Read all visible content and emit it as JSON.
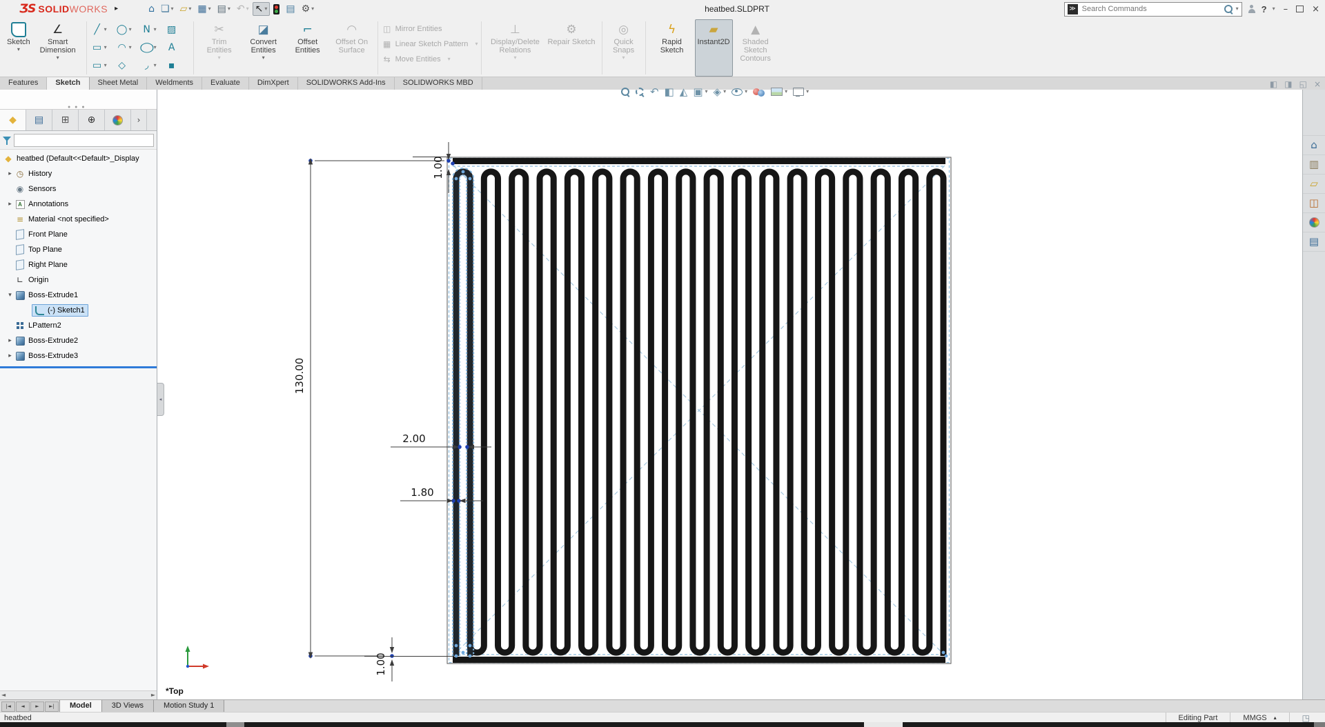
{
  "window": {
    "brand_mark": "ƷS",
    "brand_bold": "SOLID",
    "brand_light": "WORKS",
    "flyout_arrow": "▸",
    "title": "heatbed.SLDPRT",
    "search_placeholder": "Search Commands",
    "search_icon_glyph": "≫",
    "help_label": "?",
    "minimize_glyph": "–",
    "close_glyph": "×"
  },
  "quick_access": [
    {
      "name": "home",
      "glyph": "⌂",
      "color": "#2f6f9e"
    },
    {
      "name": "new-document",
      "glyph": "❏",
      "color": "#4a7d9e",
      "dd": true
    },
    {
      "name": "open",
      "glyph": "▱",
      "color": "#c9a227",
      "dd": true
    },
    {
      "name": "save",
      "glyph": "▦",
      "color": "#3a6b96",
      "dd": true
    },
    {
      "name": "print",
      "glyph": "▤",
      "color": "#5a6b76",
      "dd": true
    },
    {
      "name": "undo",
      "glyph": "↶",
      "color": "#b5b5b5",
      "dd": true,
      "disabled": true
    },
    {
      "name": "select",
      "glyph": "↖",
      "color": "#222222",
      "dd": true,
      "active": true
    },
    {
      "name": "xpert-tools",
      "glyph": "css:traffic"
    },
    {
      "name": "file-properties",
      "glyph": "▤",
      "color": "#4a7d9e"
    },
    {
      "name": "options",
      "glyph": "⚙",
      "color": "#555555",
      "dd": true
    }
  ],
  "ribbon": {
    "big": [
      {
        "name": "sketch",
        "label": "Sketch",
        "icon": "css:bigsketch",
        "dd": true,
        "enabled": true
      },
      {
        "name": "smart-dimension",
        "label": "Smart Dimension",
        "glyph": "∠",
        "color": "#2a2a2a",
        "dd": true,
        "enabled": true
      }
    ],
    "entity_grid": [
      [
        {
          "name": "line",
          "glyph": "╱",
          "dd": true
        },
        {
          "name": "circle",
          "glyph": "◯",
          "dd": true
        },
        {
          "name": "spline",
          "glyph": "N",
          "dd": true
        },
        {
          "name": "sketch-picture",
          "glyph": "▨"
        }
      ],
      [
        {
          "name": "corner-rectangle",
          "glyph": "▭",
          "dd": true
        },
        {
          "name": "arc",
          "glyph": "◠",
          "dd": true
        },
        {
          "name": "ellipse",
          "glyph": "◯",
          "dd": true
        },
        {
          "name": "text",
          "glyph": "A"
        }
      ],
      [
        {
          "name": "straight-slot",
          "glyph": "▭",
          "dd": true
        },
        {
          "name": "polygon",
          "glyph": "◇"
        },
        {
          "name": "fillet",
          "glyph": "◞",
          "dd": true
        },
        {
          "name": "point",
          "glyph": "▪"
        }
      ]
    ],
    "modify": [
      {
        "name": "trim-entities",
        "label": "Trim Entities",
        "glyph": "✂",
        "enabled": false,
        "dd": true
      },
      {
        "name": "convert-entities",
        "label": "Convert Entities",
        "glyph": "◪",
        "color": "#4a7d9e",
        "enabled": true,
        "dd": true
      },
      {
        "name": "offset-entities",
        "label": "Offset Entities",
        "glyph": "⌐",
        "color": "#1f7f95",
        "enabled": true
      },
      {
        "name": "offset-on-surface",
        "label": "Offset On Surface",
        "glyph": "◠",
        "enabled": false
      }
    ],
    "pattern": [
      {
        "name": "mirror-entities",
        "label": "Mirror Entities",
        "glyph": "◫",
        "enabled": false
      },
      {
        "name": "linear-sketch-pattern",
        "label": "Linear Sketch Pattern",
        "glyph": "▦",
        "enabled": false,
        "dd": true
      },
      {
        "name": "move-entities",
        "label": "Move Entities",
        "glyph": "⇆",
        "enabled": false,
        "dd": true
      }
    ],
    "tools": [
      {
        "name": "display-delete-relations",
        "label": "Display/Delete Relations",
        "glyph": "⊥",
        "enabled": false,
        "dd": true
      },
      {
        "name": "repair-sketch",
        "label": "Repair Sketch",
        "glyph": "⚙",
        "enabled": false
      }
    ],
    "snaps": [
      {
        "name": "quick-snaps",
        "label": "Quick Snaps",
        "glyph": "◎",
        "enabled": false,
        "dd": true
      }
    ],
    "right": [
      {
        "name": "rapid-sketch",
        "label": "Rapid Sketch",
        "glyph": "ϟ",
        "color": "#d9a018",
        "enabled": true
      },
      {
        "name": "instant2d",
        "label": "Instant2D",
        "glyph": "▰",
        "color": "#caa53d",
        "enabled": true,
        "pressed": true
      },
      {
        "name": "shaded-sketch-contours",
        "label": "Shaded Sketch Contours",
        "glyph": "▲",
        "enabled": false
      }
    ]
  },
  "command_tabs": {
    "items": [
      "Features",
      "Sketch",
      "Sheet Metal",
      "Weldments",
      "Evaluate",
      "DimXpert",
      "SOLIDWORKS Add-Ins",
      "SOLIDWORKS MBD"
    ],
    "active": "Sketch"
  },
  "tab_window_controls": [
    {
      "name": "viewport-pane-left",
      "glyph": "◧"
    },
    {
      "name": "viewport-pane-right",
      "glyph": "◨"
    },
    {
      "name": "restore-document",
      "glyph": "◱"
    },
    {
      "name": "close-document",
      "glyph": "×"
    }
  ],
  "headsup": [
    {
      "name": "zoom-to-fit",
      "icon": "css:mag"
    },
    {
      "name": "zoom-to-area",
      "icon": "css:magarea"
    },
    {
      "name": "previous-view",
      "glyph": "↶"
    },
    {
      "name": "section-view",
      "glyph": "◧"
    },
    {
      "name": "dynamic-annotation-views",
      "glyph": "◭"
    },
    {
      "name": "view-orientation",
      "glyph": "▣",
      "dd": true
    },
    {
      "name": "display-style",
      "glyph": "◈",
      "dd": true
    },
    {
      "name": "hide-show-items",
      "icon": "css:eye",
      "dd": true
    },
    {
      "name": "edit-appearance",
      "icon": "css:balls"
    },
    {
      "name": "apply-scene",
      "icon": "css:scene",
      "dd": true
    },
    {
      "name": "view-settings",
      "icon": "css:monitor",
      "dd": true
    }
  ],
  "panel_tabs": [
    {
      "name": "featuremanager-tree",
      "glyph": "◆",
      "color": "#e3b33c",
      "active": true
    },
    {
      "name": "propertymanager",
      "glyph": "▤",
      "color": "#3a6b96"
    },
    {
      "name": "configurationmanager",
      "glyph": "⊞",
      "color": "#555555"
    },
    {
      "name": "dimxpertmanager",
      "glyph": "⊕",
      "color": "#333333"
    },
    {
      "name": "displaymanager",
      "icon": "css:ball"
    },
    {
      "name": "expand-pane",
      "glyph": "›",
      "color": "#444444",
      "chev": true
    }
  ],
  "feature_tree": {
    "items": [
      {
        "icon": "part",
        "label": "heatbed (Default<<Default>_Display",
        "indent": 0
      },
      {
        "arrow": "▸",
        "icon": "history",
        "label": "History",
        "indent": 1
      },
      {
        "icon": "sensors",
        "label": "Sensors",
        "indent": 1
      },
      {
        "arrow": "▸",
        "icon": "annotations",
        "label": "Annotations",
        "indent": 1
      },
      {
        "icon": "material",
        "label": "Material <not specified>",
        "indent": 1
      },
      {
        "icon": "plane",
        "label": "Front Plane",
        "indent": 1
      },
      {
        "icon": "plane",
        "label": "Top Plane",
        "indent": 1
      },
      {
        "icon": "plane",
        "label": "Right Plane",
        "indent": 1
      },
      {
        "icon": "origin",
        "label": "Origin",
        "indent": 1
      },
      {
        "arrow": "▾",
        "icon": "extrude",
        "label": "Boss-Extrude1",
        "indent": 1
      },
      {
        "icon": "sketch",
        "label": "(-) Sketch1",
        "indent": 2,
        "selected": true
      },
      {
        "icon": "lpattern",
        "label": "LPattern2",
        "indent": 1
      },
      {
        "arrow": "▸",
        "icon": "extrude",
        "label": "Boss-Extrude2",
        "indent": 1
      },
      {
        "arrow": "▸",
        "icon": "extrude",
        "label": "Boss-Extrude3",
        "indent": 1
      }
    ]
  },
  "viewport": {
    "view_label": "*Top",
    "dimensions": {
      "height": "130.00",
      "pitch": "2.00",
      "trace_width": "1.80",
      "top_margin": "1.00",
      "bottom_margin": "1.00"
    },
    "sketch": {
      "top_arcs": 18,
      "trace_color": "#161616",
      "selected_halo": "#7fb3dd",
      "construction_color": "#a5c8e0",
      "dashed_color": "#8abbdd",
      "point_color": "#1d3fb0",
      "vertex_color": "#6fa8dc"
    }
  },
  "right_pane": [
    {
      "name": "home",
      "glyph": "⌂",
      "color": "#3a6b96"
    },
    {
      "name": "design-library",
      "glyph": "▥",
      "color": "#8a7b5a"
    },
    {
      "name": "file-explorer",
      "glyph": "▱",
      "color": "#c9a227"
    },
    {
      "name": "view-palette",
      "glyph": "◫",
      "color": "#b86c2e"
    },
    {
      "name": "appearances-scenes",
      "icon": "css:ball"
    },
    {
      "name": "custom-properties",
      "glyph": "▤",
      "color": "#3a6b96"
    }
  ],
  "bottom_tabs": {
    "nav": [
      "|◄",
      "◄",
      "►",
      "►|"
    ],
    "items": [
      "Model",
      "3D Views",
      "Motion Study 1"
    ],
    "active": "Model"
  },
  "status_bar": {
    "document": "heatbed",
    "mode": "Editing Part",
    "units": "MMGS",
    "units_arrow": "▴",
    "tag_glyph": "◳"
  }
}
